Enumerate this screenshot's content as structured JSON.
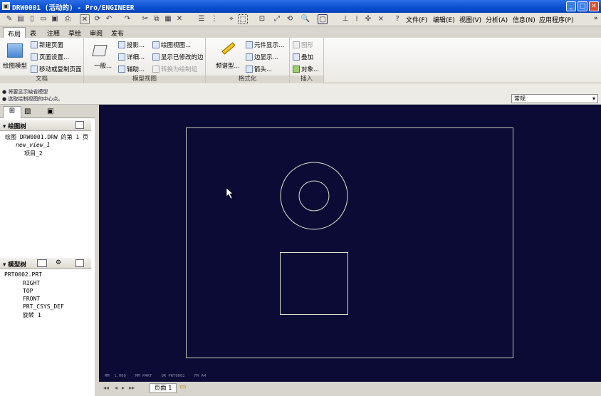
{
  "window": {
    "title": "DRW0001 (活动的) - Pro/ENGINEER"
  },
  "menu": {
    "file": "文件(F)",
    "edit": "编辑(E)",
    "view": "视图(V)",
    "analysis": "分析(A)",
    "info": "信息(N)",
    "apps": "应用程序(P)"
  },
  "tabs": [
    "布局",
    "表",
    "注释",
    "草绘",
    "审阅",
    "发布"
  ],
  "ribbon": {
    "doc": {
      "big": "绘图模型",
      "new_page": "新建页面",
      "page_setup": "页面设置...",
      "move_copy": "移动或复制页面",
      "label": "文档"
    },
    "model_view": {
      "general": "一般...",
      "projection": "投影...",
      "detail": "详细...",
      "auxiliary": "辅助...",
      "drawing_view": "绘图视图...",
      "show_modified": "显示已修改的边",
      "convert": "转换为绘制组",
      "label": "模型视图"
    },
    "format": {
      "repeat": "频谱型...",
      "elem_display": "元件显示...",
      "edge_display": "边显示...",
      "arrow": "箭头...",
      "label": "格式化"
    },
    "insert": {
      "graph": "图形",
      "overlay": "叠加",
      "object": "对象...",
      "label": "插入"
    }
  },
  "messages": {
    "line1": "● 将要显示缺省模型",
    "line2": "● 选取绘制视图的中心点。"
  },
  "filter": {
    "value": "常规"
  },
  "drawing_tree": {
    "header": "绘图树",
    "root": "绘图 DRW0001.DRW 的第 1 页",
    "items": [
      "new_view_1",
      "项目_2"
    ]
  },
  "model_tree": {
    "header": "模型树",
    "root": "PRT0002.PRT",
    "items": [
      "RIGHT",
      "TOP",
      "FRONT",
      "PRT_CSYS_DEF",
      "旋转 1"
    ]
  },
  "canvas": {
    "footer": "MM  1.000    MM PART    OR PRT0002    FR A4"
  },
  "status": {
    "page_tab": "页面 1"
  }
}
